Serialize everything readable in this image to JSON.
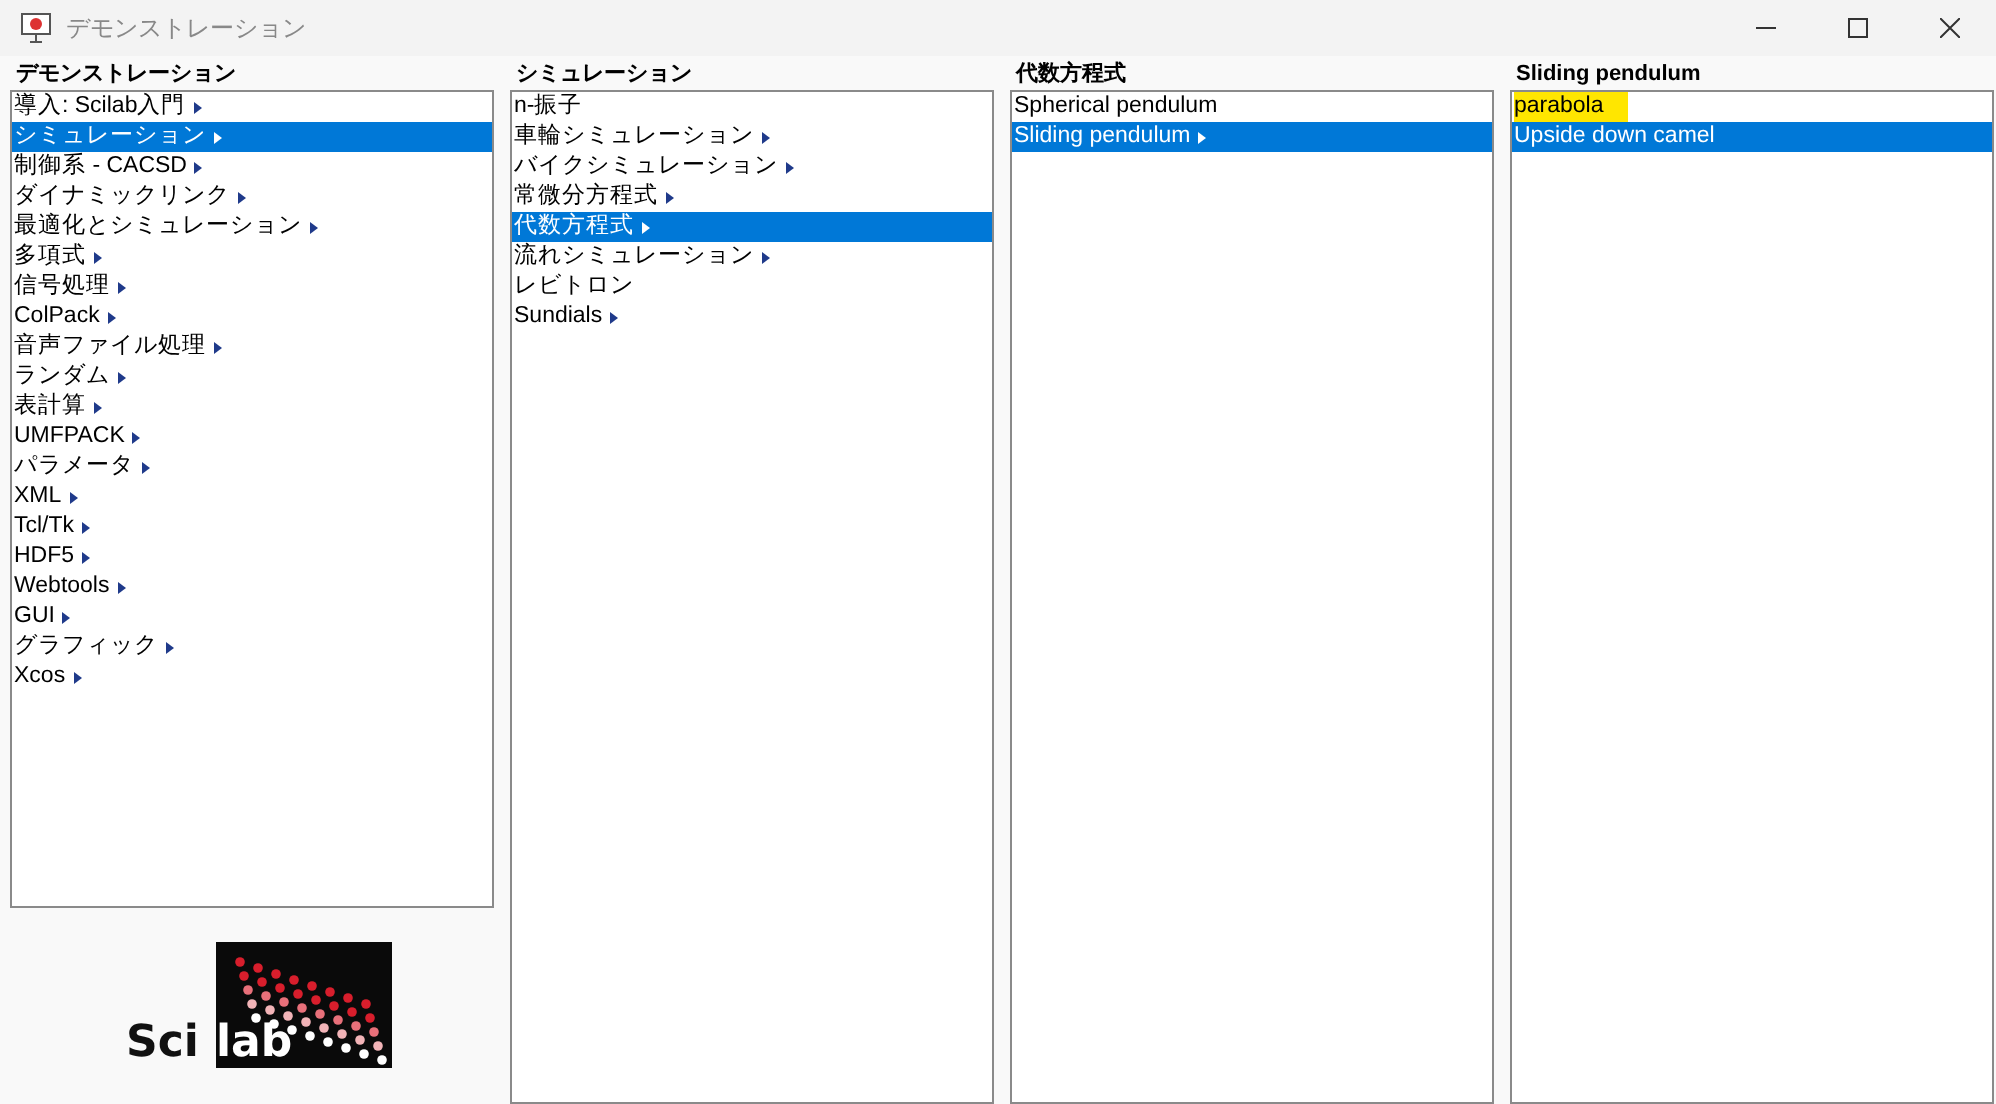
{
  "window": {
    "title": "デモンストレーション"
  },
  "columns": [
    {
      "title": "デモンストレーション",
      "items": [
        {
          "label": "導入: Scilab入門",
          "submenu": true,
          "selected": false,
          "highlighted": false
        },
        {
          "label": "シミュレーション",
          "submenu": true,
          "selected": true,
          "highlighted": false
        },
        {
          "label": "制御系 - CACSD",
          "submenu": true,
          "selected": false,
          "highlighted": false
        },
        {
          "label": "ダイナミックリンク",
          "submenu": true,
          "selected": false,
          "highlighted": false
        },
        {
          "label": "最適化とシミュレーション",
          "submenu": true,
          "selected": false,
          "highlighted": false
        },
        {
          "label": "多項式",
          "submenu": true,
          "selected": false,
          "highlighted": false
        },
        {
          "label": "信号処理",
          "submenu": true,
          "selected": false,
          "highlighted": false
        },
        {
          "label": "ColPack",
          "submenu": true,
          "selected": false,
          "highlighted": false
        },
        {
          "label": "音声ファイル処理",
          "submenu": true,
          "selected": false,
          "highlighted": false
        },
        {
          "label": "ランダム",
          "submenu": true,
          "selected": false,
          "highlighted": false
        },
        {
          "label": "表計算",
          "submenu": true,
          "selected": false,
          "highlighted": false
        },
        {
          "label": "UMFPACK",
          "submenu": true,
          "selected": false,
          "highlighted": false
        },
        {
          "label": "パラメータ",
          "submenu": true,
          "selected": false,
          "highlighted": false
        },
        {
          "label": "XML",
          "submenu": true,
          "selected": false,
          "highlighted": false
        },
        {
          "label": "Tcl/Tk",
          "submenu": true,
          "selected": false,
          "highlighted": false
        },
        {
          "label": "HDF5",
          "submenu": true,
          "selected": false,
          "highlighted": false
        },
        {
          "label": "Webtools",
          "submenu": true,
          "selected": false,
          "highlighted": false
        },
        {
          "label": "GUI",
          "submenu": true,
          "selected": false,
          "highlighted": false
        },
        {
          "label": "グラフィック",
          "submenu": true,
          "selected": false,
          "highlighted": false
        },
        {
          "label": "Xcos",
          "submenu": true,
          "selected": false,
          "highlighted": false
        }
      ]
    },
    {
      "title": "シミュレーション",
      "items": [
        {
          "label": "n-振子",
          "submenu": false,
          "selected": false,
          "highlighted": false
        },
        {
          "label": "車輪シミュレーション",
          "submenu": true,
          "selected": false,
          "highlighted": false
        },
        {
          "label": "バイクシミュレーション",
          "submenu": true,
          "selected": false,
          "highlighted": false
        },
        {
          "label": "常微分方程式",
          "submenu": true,
          "selected": false,
          "highlighted": false
        },
        {
          "label": "代数方程式",
          "submenu": true,
          "selected": true,
          "highlighted": false
        },
        {
          "label": "流れシミュレーション",
          "submenu": true,
          "selected": false,
          "highlighted": false
        },
        {
          "label": "レビトロン",
          "submenu": false,
          "selected": false,
          "highlighted": false
        },
        {
          "label": "Sundials",
          "submenu": true,
          "selected": false,
          "highlighted": false
        }
      ]
    },
    {
      "title": "代数方程式",
      "items": [
        {
          "label": "Spherical pendulum",
          "submenu": false,
          "selected": false,
          "highlighted": false
        },
        {
          "label": "Sliding pendulum",
          "submenu": true,
          "selected": true,
          "highlighted": false
        }
      ]
    },
    {
      "title": "Sliding pendulum",
      "items": [
        {
          "label": "parabola",
          "submenu": false,
          "selected": false,
          "highlighted": true
        },
        {
          "label": "Upside down camel",
          "submenu": false,
          "selected": true,
          "highlighted": false
        }
      ]
    }
  ],
  "logo": {
    "left": "Sci",
    "right": "lab"
  }
}
